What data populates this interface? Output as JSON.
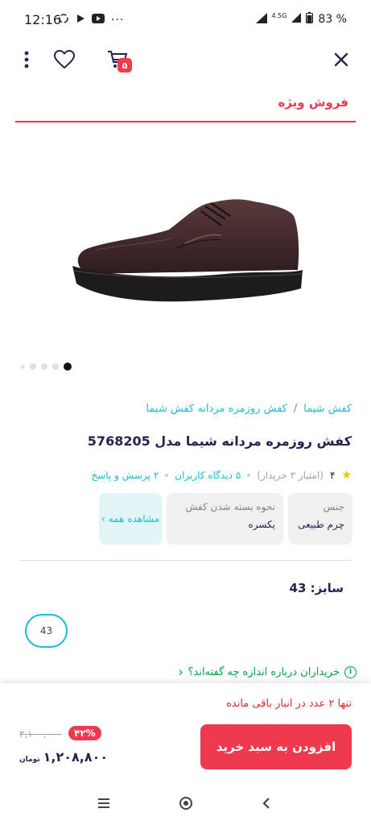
{
  "status": {
    "time": "12:16",
    "network": "4.5G",
    "battery": "83 %"
  },
  "toolbar": {
    "cart_count": "۵"
  },
  "section": {
    "title": "فروش ویژه"
  },
  "gallery": {
    "dot_count": 5,
    "active_index": 4
  },
  "breadcrumb": {
    "items": [
      "کفش شیما",
      "کفش روزمره مردانه کفش شیما"
    ],
    "separator": "/"
  },
  "product": {
    "title": "کفش روزمره مردانه شیما مدل 5768205",
    "rating": "۴",
    "rating_note": "(امتیاز ۳ خریدار)",
    "reviews_link": "۵ دیدگاه کاربران",
    "qa_link": "۲ پرسش و پاسخ"
  },
  "attributes": [
    {
      "key": "جنس",
      "value": "چرم طبیعی"
    },
    {
      "key": "نحوه بسته شدن کفش",
      "value": "یکسره"
    }
  ],
  "view_all": {
    "label": "مشاهده همه"
  },
  "size": {
    "label": "سایز: 43",
    "selected": "43"
  },
  "size_info": {
    "label": "خریداران درباره اندازه چه گفته‌اند؟"
  },
  "purchase": {
    "stock_message": "تنها ۲ عدد در انبار باقی مانده",
    "add_button": "افزودن به سبد خرید",
    "discount": "۴۲%",
    "old_price": "۲,۱۰۰,۰۰۰",
    "final_price": "۱,۲۰۸,۸۰۰",
    "currency": "تومان"
  },
  "colors": {
    "accent": "#ef394e",
    "link": "#19bfd3",
    "success": "#00a049",
    "text": "#23254e"
  }
}
